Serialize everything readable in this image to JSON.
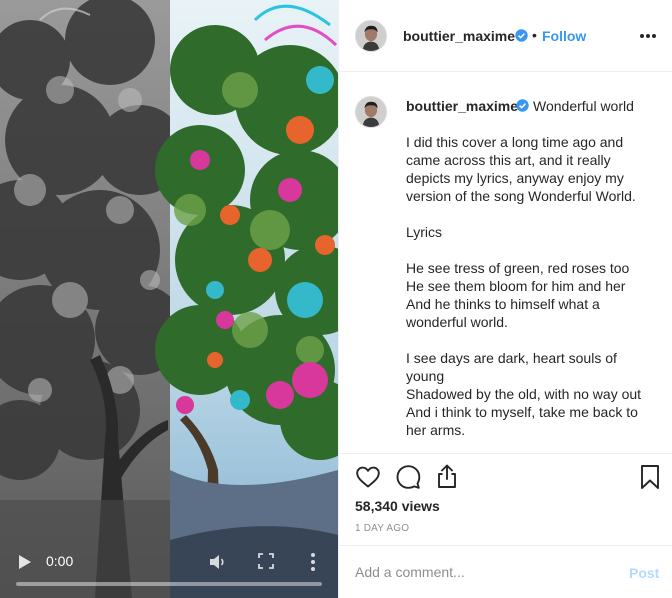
{
  "post": {
    "username": "bouttier_maxime",
    "verified": true,
    "separator": "•",
    "follow_label": "Follow",
    "options_icon": "more-horizontal-icon"
  },
  "caption": {
    "username": "bouttier_maxime",
    "title": "Wonderful world",
    "lines": [
      "I did this cover a long time ago and",
      "came across this art, and it really",
      "depicts my lyrics, anyway enjoy my",
      "version of the song Wonderful World.",
      "",
      "Lyrics",
      "",
      "He see tress of green, red roses too",
      "He see them bloom for him and her",
      "And he thinks to himself what a",
      "wonderful world.",
      "",
      "I see days are dark, heart souls of",
      "young",
      "Shadowed by the old, with no way out",
      "And i think to myself, take me back to",
      "her arms."
    ]
  },
  "video": {
    "time": "0:00",
    "progress_fraction": 0.0,
    "icons": [
      "play-icon",
      "volume-icon",
      "fullscreen-icon",
      "more-vertical-icon"
    ]
  },
  "actions": {
    "icons": [
      "heart-icon",
      "comment-bubble-icon",
      "share-icon",
      "bookmark-icon"
    ],
    "views": "58,340 views",
    "age": "1 DAY AGO"
  },
  "comment_box": {
    "placeholder": "Add a comment...",
    "post_label": "Post"
  },
  "colors": {
    "link_blue": "#3897f0",
    "verified_blue": "#3897f0",
    "post_disabled": "#b3dbff",
    "muted_text": "#8e8e8e",
    "border": "#efefef"
  }
}
